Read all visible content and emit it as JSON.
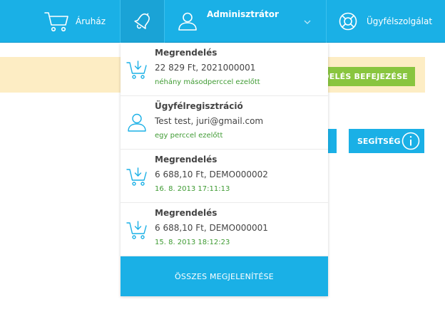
{
  "header": {
    "shop_label": "Áruház",
    "admin_label": "Adminisztrátor",
    "support_label": "Ügyfélszolgálat"
  },
  "background": {
    "finish_label": "NDELÉS BEFEJEZÉSE",
    "help_label": "SEGÍTSÉG"
  },
  "notifications": {
    "items": [
      {
        "icon": "cart-icon",
        "title": "Megrendelés",
        "detail": "22 829 Ft, 2021000001",
        "time": "néhány másodperccel ezelőtt"
      },
      {
        "icon": "user-icon",
        "title": "Ügyfélregisztráció",
        "detail": "Test test, juri@gmail.com",
        "time": "egy perccel ezelőtt"
      },
      {
        "icon": "cart-icon",
        "title": "Megrendelés",
        "detail": "6 688,10 Ft, DEMO000002",
        "time": "16. 8. 2013 17:11:13"
      },
      {
        "icon": "cart-icon",
        "title": "Megrendelés",
        "detail": "6 688,10 Ft, DEMO000001",
        "time": "15. 8. 2013 18:12:23"
      }
    ],
    "show_all_label": "ÖSSZES MEGJELENÍTÉSE"
  },
  "colors": {
    "primary": "#1ab0e6",
    "success_green": "#3f9b33",
    "button_green": "#89c53f",
    "banner_yellow": "#fdedc4"
  }
}
